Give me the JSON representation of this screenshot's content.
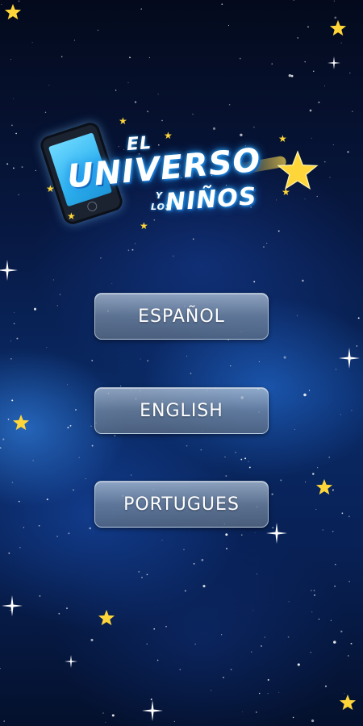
{
  "logo": {
    "el": "EL",
    "universo": "UNIVERSO",
    "y": "Y",
    "los": "LOS",
    "ninos": "NIÑOS"
  },
  "languages": [
    {
      "label": "ESPAÑOL"
    },
    {
      "label": "ENGLISH"
    },
    {
      "label": "PORTUGUES"
    }
  ],
  "colors": {
    "star_yellow": "#ffd63a",
    "sky_dark": "#040a1c",
    "sky_blue": "#0a2a66",
    "button_glass": "#7488a0",
    "logo_glow": "#33b5ff"
  },
  "icons": {
    "phone": "phone-icon",
    "star": "star-icon",
    "sparkle": "sparkle-icon"
  }
}
